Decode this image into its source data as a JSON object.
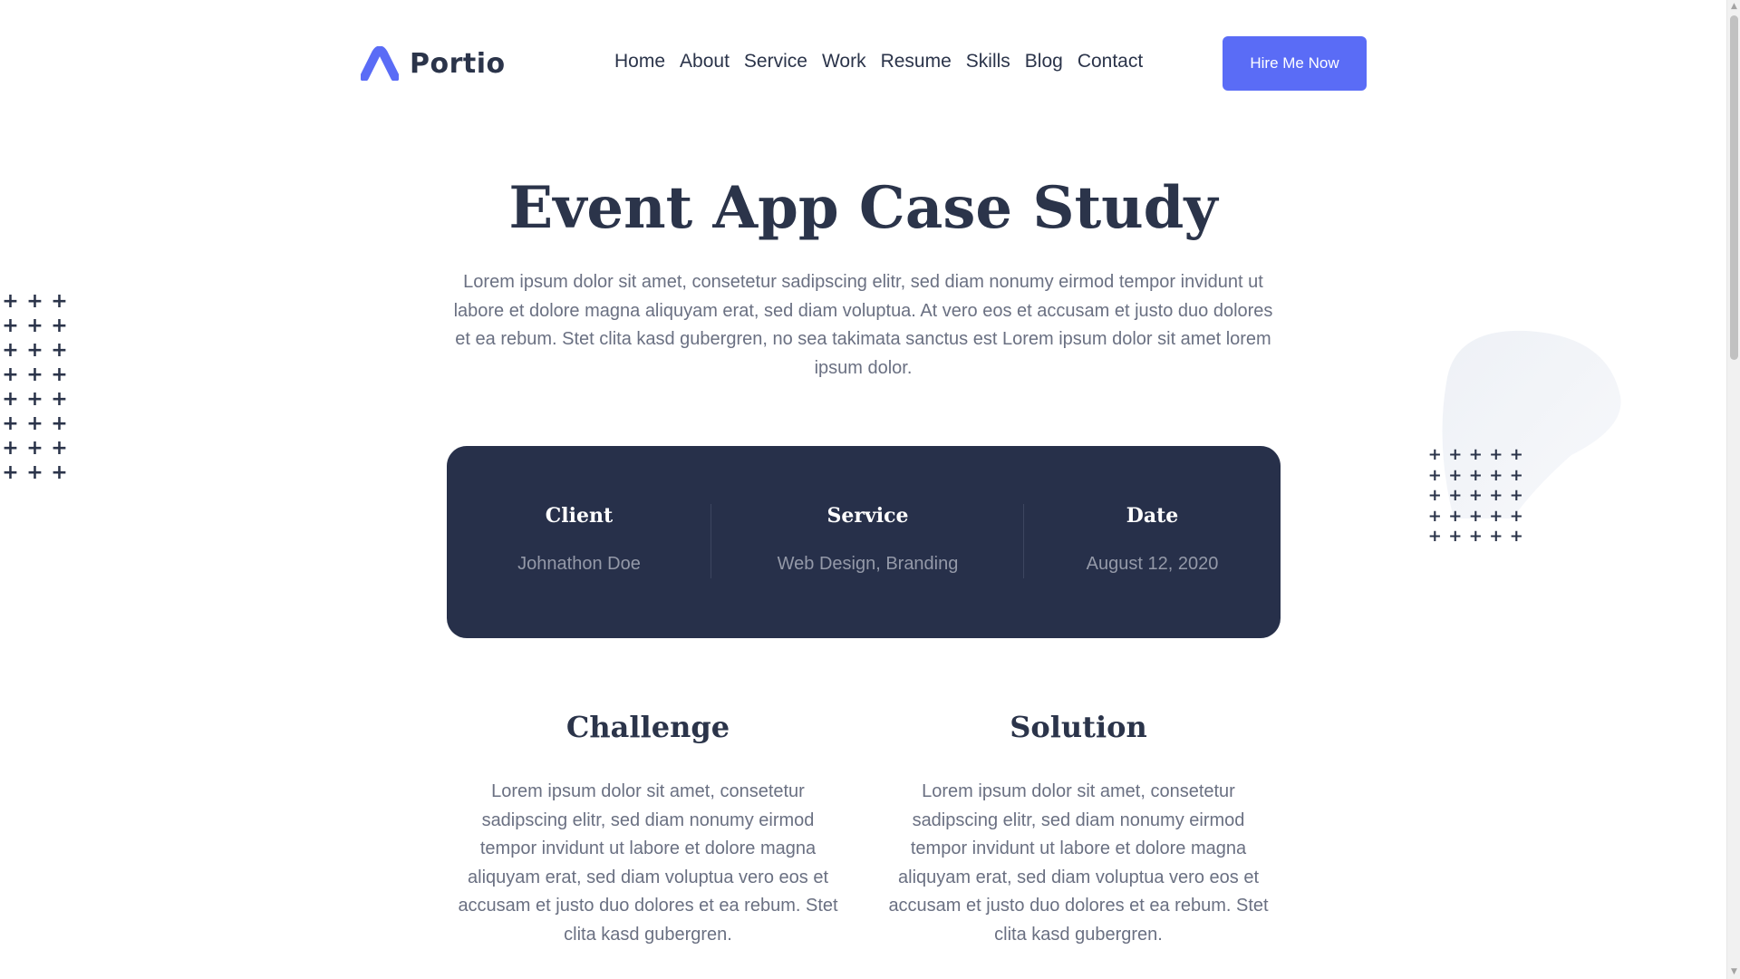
{
  "brand": {
    "name": "Portio",
    "accent_color": "#5a6cf6",
    "dark_color": "#27304a"
  },
  "nav": {
    "items": [
      "Home",
      "About",
      "Service",
      "Work",
      "Resume",
      "Skills",
      "Blog",
      "Contact"
    ],
    "cta_label": "Hire Me Now"
  },
  "hero": {
    "title": "Event App Case Study",
    "intro": "Lorem ipsum dolor sit amet, consetetur sadipscing elitr, sed diam nonumy eirmod tempor invidunt ut labore et dolore magna aliquyam erat, sed diam voluptua. At vero eos et accusam et justo duo dolores et ea rebum. Stet clita kasd gubergren, no sea takimata sanctus est Lorem ipsum dolor sit amet lorem ipsum dolor."
  },
  "project_info": [
    {
      "label": "Client",
      "value": "Johnathon Doe"
    },
    {
      "label": "Service",
      "value": "Web Design, Branding"
    },
    {
      "label": "Date",
      "value": "August 12, 2020"
    }
  ],
  "challenge": {
    "heading": "Challenge",
    "body": "Lorem ipsum dolor sit amet, consetetur sadipscing elitr, sed diam nonumy eirmod tempor invidunt ut labore et dolore magna aliquyam erat, sed diam voluptua vero eos et accusam et justo duo dolores et ea rebum. Stet clita kasd gubergren."
  },
  "solution": {
    "heading": "Solution",
    "body": "Lorem ipsum dolor sit amet, consetetur sadipscing elitr, sed diam nonumy eirmod tempor invidunt ut labore et dolore magna aliquyam erat, sed diam voluptua vero eos et accusam et justo duo dolores et ea rebum. Stet clita kasd gubergren."
  },
  "icons": {
    "logo": "portio-logo-icon",
    "decor_plus": "plus-icon",
    "scroll_up": "scroll-up-arrow-icon",
    "scroll_down": "scroll-down-arrow-icon"
  }
}
